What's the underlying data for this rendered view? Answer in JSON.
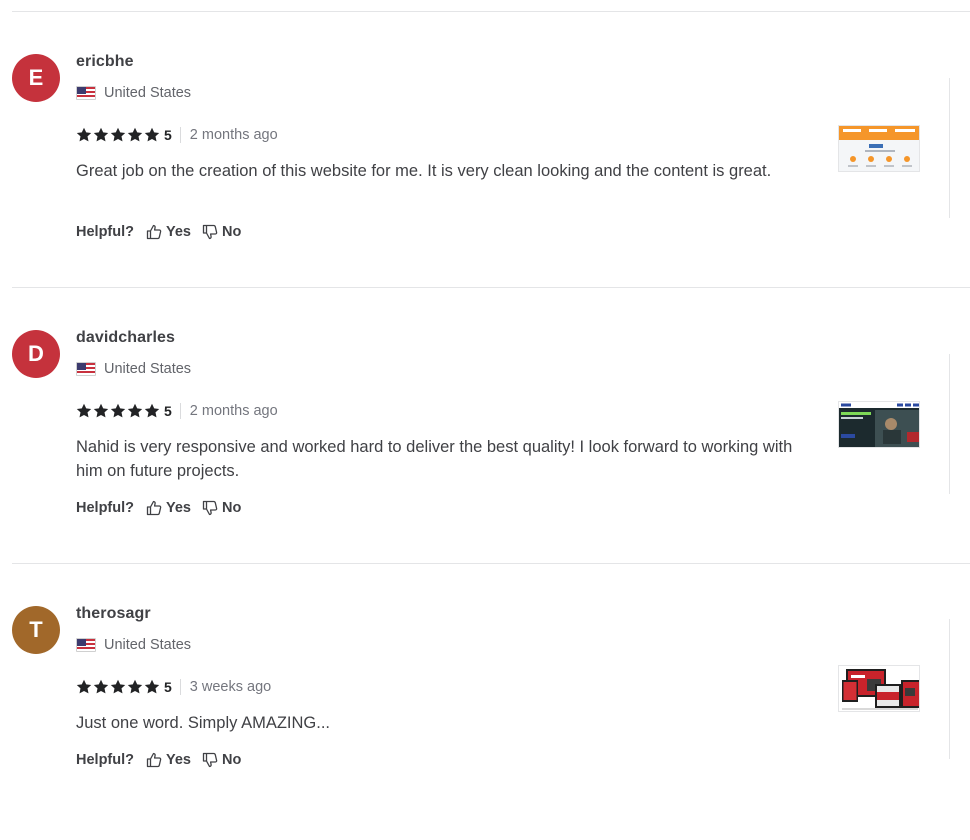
{
  "reviews": [
    {
      "initial": "E",
      "avatar_color": "#c5323c",
      "username": "ericbhe",
      "country": "United States",
      "rating": "5",
      "time": "2 months ago",
      "comment": "Great job on the creation of this website for me. It is very clean looking and the content is great.",
      "helpful_label": "Helpful?",
      "yes_label": "Yes",
      "no_label": "No",
      "thumbnail": "orange-website-preview"
    },
    {
      "initial": "D",
      "avatar_color": "#c5323c",
      "username": "davidcharles",
      "country": "United States",
      "rating": "5",
      "time": "2 months ago",
      "comment": "Nahid is very responsive and worked hard to deliver the best quality! I look forward to working with him on future projects.",
      "helpful_label": "Helpful?",
      "yes_label": "Yes",
      "no_label": "No",
      "thumbnail": "dark-website-preview"
    },
    {
      "initial": "T",
      "avatar_color": "#a1682a",
      "username": "therosagr",
      "country": "United States",
      "rating": "5",
      "time": "3 weeks ago",
      "comment": "Just one word. Simply AMAZING...",
      "helpful_label": "Helpful?",
      "yes_label": "Yes",
      "no_label": "No",
      "thumbnail": "multi-device-preview"
    }
  ],
  "colors": {
    "text": "#404145",
    "muted": "#74767e",
    "star": "#222325",
    "divider": "#e4e5e7"
  }
}
